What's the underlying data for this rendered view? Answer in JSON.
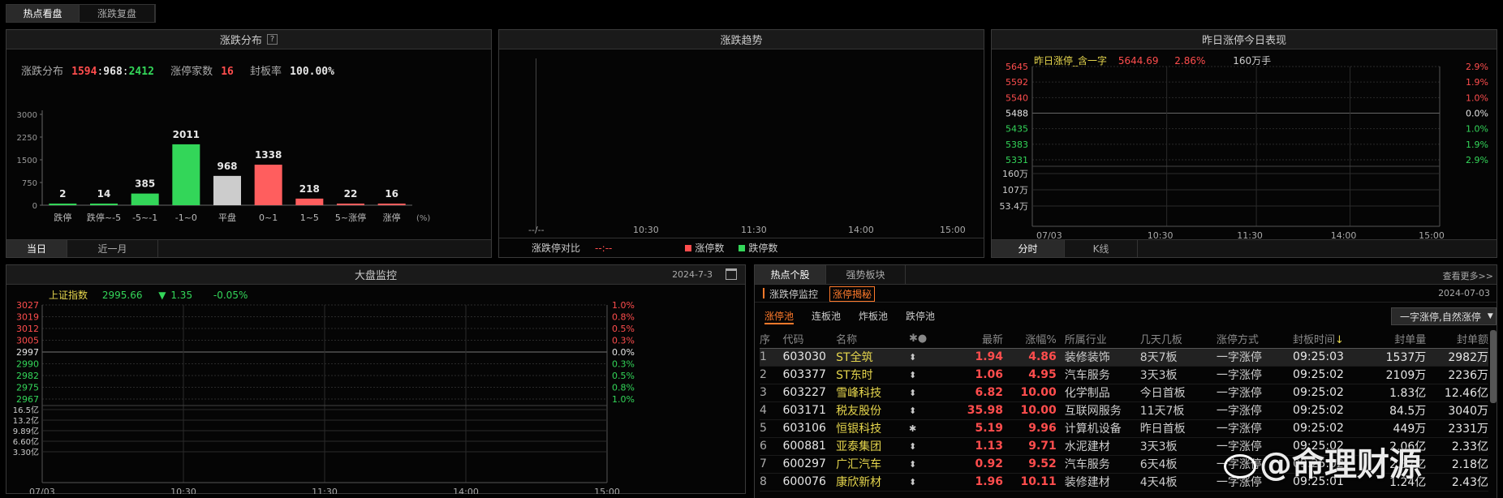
{
  "top_tabs": [
    "热点看盘",
    "涨跌复盘"
  ],
  "dist": {
    "title": "涨跌分布",
    "help": "?",
    "label": "涨跌分布",
    "up": "1594",
    "sep1": ":",
    "flat": "968",
    "sep2": ":",
    "down": "2412",
    "zt_label": "涨停家数",
    "zt_value": "16",
    "fbl_label": "封板率",
    "fbl_value": "100.00%",
    "tabs": [
      "当日",
      "近一月"
    ],
    "unit": "(%)"
  },
  "trend": {
    "title": "涨跌趋势",
    "xticks": [
      "--/--",
      "10:30",
      "11:30",
      "14:00",
      "15:00"
    ],
    "ratio_label": "涨跌停对比",
    "ratio_value": "--:--",
    "legend_up": "涨停数",
    "legend_down": "跌停数"
  },
  "yzt": {
    "title": "昨日涨停今日表现",
    "name": "昨日涨停_含一字",
    "price": "5644.69",
    "pct": "2.86%",
    "vol": "160万手",
    "yprices": [
      "5645",
      "5592",
      "5540",
      "5488",
      "5435",
      "5383",
      "5331"
    ],
    "ypcts": [
      "2.9%",
      "1.9%",
      "1.0%",
      "0.0%",
      "1.0%",
      "1.9%",
      "2.9%"
    ],
    "yvol": [
      "160万",
      "107万",
      "53.4万"
    ],
    "xticks": [
      "07/03",
      "10:30",
      "11:30",
      "14:00",
      "15:00"
    ],
    "tabs": [
      "分时",
      "K线"
    ]
  },
  "market": {
    "title": "大盘监控",
    "date": "2024-7-3",
    "index_name": "上证指数",
    "index_value": "2995.66",
    "arrow": "▼",
    "change": "1.35",
    "change_pct": "-0.05%",
    "yprices": [
      "3027",
      "3019",
      "3012",
      "3005",
      "2997",
      "2990",
      "2982",
      "2975",
      "2967"
    ],
    "ypcts": [
      "1.0%",
      "0.8%",
      "0.5%",
      "0.3%",
      "0.0%",
      "0.3%",
      "0.5%",
      "0.8%",
      "1.0%"
    ],
    "yvol": [
      "16.5亿",
      "13.2亿",
      "9.89亿",
      "6.60亿",
      "3.30亿"
    ],
    "xticks": [
      "07/03",
      "10:30",
      "11:30",
      "14:00",
      "15:00"
    ]
  },
  "hot": {
    "tabs": [
      "热点个股",
      "强势板块"
    ],
    "more": "查看更多>>",
    "sub_left": "涨跌停监控",
    "sub_badge": "涨停揭秘",
    "date": "2024-07-03",
    "qtabs": [
      "涨停池",
      "连板池",
      "炸板池",
      "跌停池"
    ],
    "sort": "一字涨停,自然涨停",
    "headers": [
      "序",
      "代码",
      "名称",
      "最新",
      "涨幅%",
      "所属行业",
      "几天几板",
      "涨停方式",
      "封板时间",
      "封单量",
      "封单额"
    ],
    "rows": [
      {
        "n": "1",
        "code": "603030",
        "name": "ST全筑",
        "price": "1.94",
        "pct": "4.86",
        "ind": "装修装饰",
        "days": "8天7板",
        "way": "一字涨停",
        "time": "09:25:03",
        "vol": "1537万",
        "amt": "2982万"
      },
      {
        "n": "2",
        "code": "603377",
        "name": "ST东时",
        "price": "1.06",
        "pct": "4.95",
        "ind": "汽车服务",
        "days": "3天3板",
        "way": "一字涨停",
        "time": "09:25:02",
        "vol": "2109万",
        "amt": "2236万"
      },
      {
        "n": "3",
        "code": "603227",
        "name": "雪峰科技",
        "price": "6.82",
        "pct": "10.00",
        "ind": "化学制品",
        "days": "今日首板",
        "way": "一字涨停",
        "time": "09:25:02",
        "vol": "1.83亿",
        "amt": "12.46亿"
      },
      {
        "n": "4",
        "code": "603171",
        "name": "税友股份",
        "price": "35.98",
        "pct": "10.00",
        "ind": "互联网服务",
        "days": "11天7板",
        "way": "一字涨停",
        "time": "09:25:02",
        "vol": "84.5万",
        "amt": "3040万"
      },
      {
        "n": "5",
        "code": "603106",
        "name": "恒银科技",
        "price": "5.19",
        "pct": "9.96",
        "ind": "计算机设备",
        "days": "昨日首板",
        "way": "一字涨停",
        "time": "09:25:02",
        "vol": "449万",
        "amt": "2331万"
      },
      {
        "n": "6",
        "code": "600881",
        "name": "亚泰集团",
        "price": "1.13",
        "pct": "9.71",
        "ind": "水泥建材",
        "days": "3天3板",
        "way": "一字涨停",
        "time": "09:25:02",
        "vol": "2.06亿",
        "amt": "2.33亿"
      },
      {
        "n": "7",
        "code": "600297",
        "name": "广汇汽车",
        "price": "0.92",
        "pct": "9.52",
        "ind": "汽车服务",
        "days": "6天4板",
        "way": "一字涨停",
        "time": "09:25:02",
        "vol": "2.37亿",
        "amt": "2.18亿"
      },
      {
        "n": "8",
        "code": "600076",
        "name": "康欣新材",
        "price": "1.96",
        "pct": "10.11",
        "ind": "装修建材",
        "days": "4天4板",
        "way": "一字涨停",
        "time": "09:25:01",
        "vol": "1.24亿",
        "amt": "2.43亿"
      }
    ]
  },
  "watermark": "@命理财源",
  "colors": {
    "up": "#ff4d4d",
    "down": "#33d659",
    "flat": "#cccccc",
    "accent": "#ff7a2b"
  },
  "chart_data": {
    "type": "bar",
    "categories": [
      "跌停",
      "跌停~-5",
      "-5~-1",
      "-1~0",
      "平盘",
      "0~1",
      "1~5",
      "5~涨停",
      "涨停"
    ],
    "values": [
      2,
      14,
      385,
      2011,
      968,
      1338,
      218,
      22,
      16
    ],
    "yticks": [
      0,
      750,
      1500,
      2250,
      3000
    ],
    "ylim": [
      0,
      3000
    ],
    "xlabel": "(%)",
    "grid": false
  }
}
